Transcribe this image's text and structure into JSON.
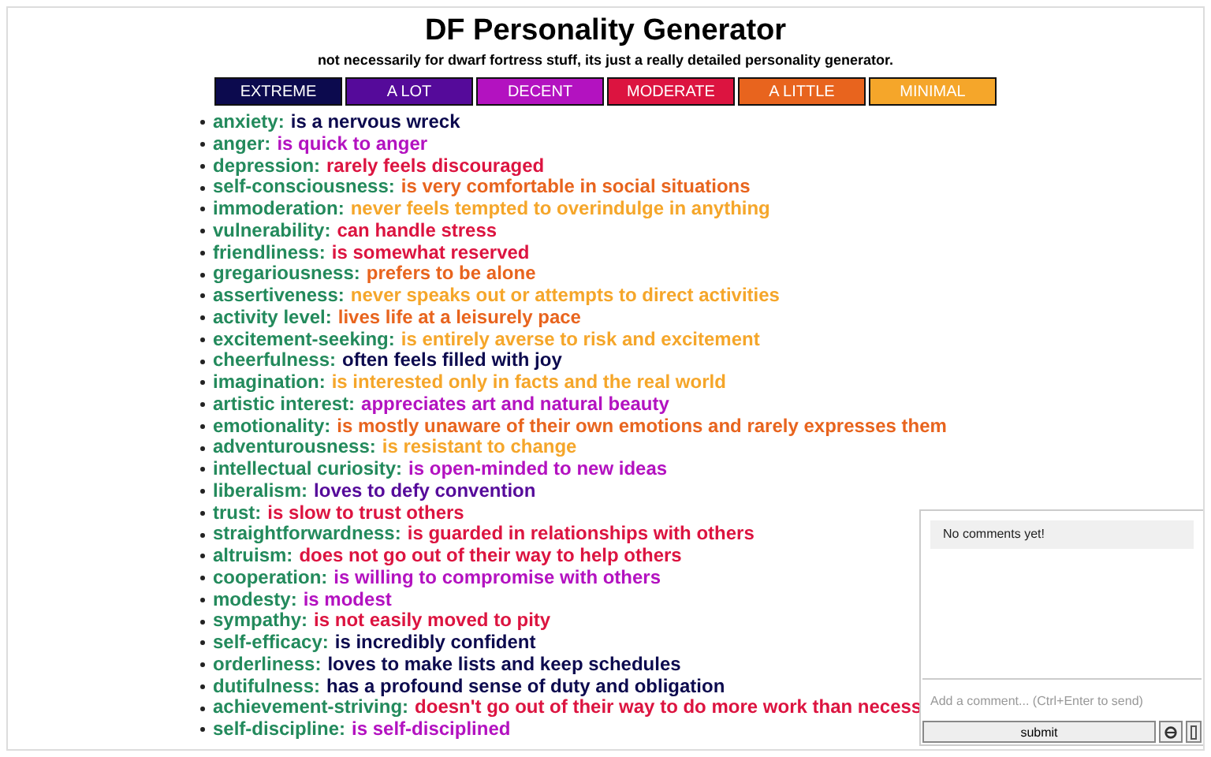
{
  "title": "DF Personality Generator",
  "subtitle": "not necessarily for dwarf fortress stuff, its just a really detailed personality generator.",
  "legend": [
    {
      "label": "EXTREME",
      "color": "#0c0a4e"
    },
    {
      "label": "A LOT",
      "color": "#550a9a"
    },
    {
      "label": "DECENT",
      "color": "#b312c0"
    },
    {
      "label": "MODERATE",
      "color": "#dc1440"
    },
    {
      "label": "A LITTLE",
      "color": "#e8641e"
    },
    {
      "label": "MINIMAL",
      "color": "#f5a62a"
    }
  ],
  "traits": [
    {
      "name": "anxiety:",
      "value": "is a nervous wreck",
      "color": "#0c0a4e"
    },
    {
      "name": "anger:",
      "value": "is quick to anger",
      "color": "#b312c0"
    },
    {
      "name": "depression:",
      "value": "rarely feels discouraged",
      "color": "#dc1440"
    },
    {
      "name": "self-consciousness:",
      "value": "is very comfortable in social situations",
      "color": "#e8641e"
    },
    {
      "name": "immoderation:",
      "value": "never feels tempted to overindulge in anything",
      "color": "#f5a62a"
    },
    {
      "name": "vulnerability:",
      "value": "can handle stress",
      "color": "#dc1440"
    },
    {
      "name": "friendliness:",
      "value": "is somewhat reserved",
      "color": "#dc1440"
    },
    {
      "name": "gregariousness:",
      "value": "prefers to be alone",
      "color": "#e8641e"
    },
    {
      "name": "assertiveness:",
      "value": "never speaks out or attempts to direct activities",
      "color": "#f5a62a"
    },
    {
      "name": "activity level:",
      "value": "lives life at a leisurely pace",
      "color": "#e8641e"
    },
    {
      "name": "excitement-seeking:",
      "value": "is entirely averse to risk and excitement",
      "color": "#f5a62a"
    },
    {
      "name": "cheerfulness:",
      "value": "often feels filled with joy",
      "color": "#0c0a4e"
    },
    {
      "name": "imagination:",
      "value": "is interested only in facts and the real world",
      "color": "#f5a62a"
    },
    {
      "name": "artistic interest:",
      "value": "appreciates art and natural beauty",
      "color": "#b312c0"
    },
    {
      "name": "emotionality:",
      "value": "is mostly unaware of their own emotions and rarely expresses them",
      "color": "#e8641e"
    },
    {
      "name": "adventurousness:",
      "value": "is resistant to change",
      "color": "#f5a62a"
    },
    {
      "name": "intellectual curiosity:",
      "value": "is open-minded to new ideas",
      "color": "#b312c0"
    },
    {
      "name": "liberalism:",
      "value": "loves to defy convention",
      "color": "#550a9a"
    },
    {
      "name": "trust:",
      "value": "is slow to trust others",
      "color": "#dc1440"
    },
    {
      "name": "straightforwardness:",
      "value": "is guarded in relationships with others",
      "color": "#dc1440"
    },
    {
      "name": "altruism:",
      "value": "does not go out of their way to help others",
      "color": "#dc1440"
    },
    {
      "name": "cooperation:",
      "value": "is willing to compromise with others",
      "color": "#b312c0"
    },
    {
      "name": "modesty:",
      "value": "is modest",
      "color": "#b312c0"
    },
    {
      "name": "sympathy:",
      "value": "is not easily moved to pity",
      "color": "#dc1440"
    },
    {
      "name": "self-efficacy:",
      "value": "is incredibly confident",
      "color": "#0c0a4e"
    },
    {
      "name": "orderliness:",
      "value": "loves to make lists and keep schedules",
      "color": "#0c0a4e"
    },
    {
      "name": "dutifulness:",
      "value": "has a profound sense of duty and obligation",
      "color": "#0c0a4e"
    },
    {
      "name": "achievement-striving:",
      "value": "doesn't go out of their way to do more work than necess",
      "color": "#dc1440"
    },
    {
      "name": "self-discipline:",
      "value": "is self-disciplined",
      "color": "#b312c0"
    }
  ],
  "comments": {
    "empty_message": "No comments yet!",
    "placeholder": "Add a comment... (Ctrl+Enter to send)",
    "submit": "submit"
  }
}
